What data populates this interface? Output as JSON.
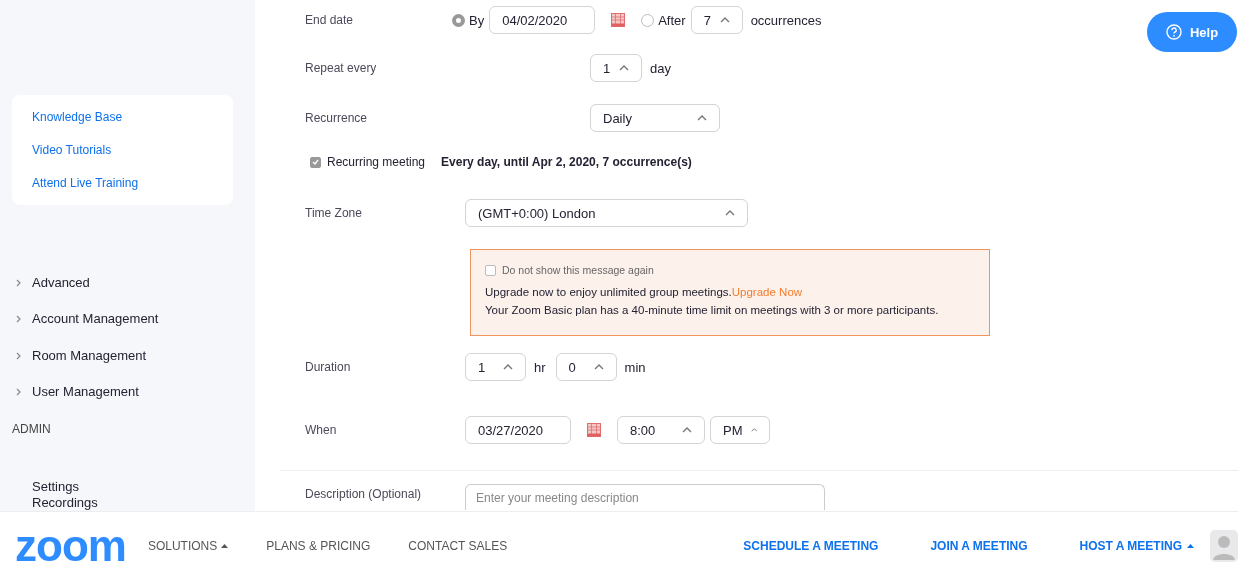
{
  "help_button": {
    "label": "Help"
  },
  "sidebar": {
    "help_links": [
      "Knowledge Base",
      "Video Tutorials",
      "Attend Live Training"
    ],
    "items": [
      {
        "label": "Advanced",
        "kind": "group",
        "expanded": false
      },
      {
        "label": "Account Management",
        "kind": "group",
        "expanded": false
      },
      {
        "label": "Room Management",
        "kind": "group",
        "expanded": false
      },
      {
        "label": "User Management",
        "kind": "group",
        "expanded": false
      },
      {
        "label": "ADMIN",
        "kind": "heading"
      },
      {
        "label": "Settings",
        "kind": "link"
      },
      {
        "label": "Recordings",
        "kind": "link"
      }
    ]
  },
  "form": {
    "end_date": {
      "label": "End date",
      "options": [
        {
          "kind": "by",
          "label": "By",
          "selected": true,
          "date": "04/02/2020"
        },
        {
          "kind": "after",
          "label": "After",
          "selected": false,
          "count": "7",
          "unit": "occurrences"
        }
      ]
    },
    "repeat_every": {
      "label": "Repeat every",
      "value": "1",
      "unit": "day"
    },
    "recurrence": {
      "label": "Recurrence",
      "value": "Daily"
    },
    "recurring": {
      "label": "Recurring meeting",
      "checked": true,
      "summary": "Every day, until Apr 2, 2020, 7 occurrence(s)"
    },
    "time_zone": {
      "label": "Time Zone",
      "value": "(GMT+0:00) London"
    },
    "alert": {
      "dont_show": {
        "label": "Do not show this message again",
        "checked": false
      },
      "upgrade_text": "Upgrade now to enjoy unlimited group meetings.",
      "upgrade_link": "Upgrade Now",
      "message": "Your Zoom Basic plan has a 40-minute time limit on meetings with 3 or more participants."
    },
    "duration": {
      "label": "Duration",
      "hours": "1",
      "hours_unit": "hr",
      "minutes": "0",
      "minutes_unit": "min"
    },
    "when": {
      "label": "When",
      "date": "03/27/2020",
      "time": "8:00",
      "ampm": "PM"
    },
    "description": {
      "label": "Description (Optional)",
      "placeholder": "Enter your meeting description"
    }
  },
  "nav": {
    "logo": "zoom",
    "left": [
      {
        "label": "SOLUTIONS",
        "has_menu": true
      },
      {
        "label": "PLANS & PRICING",
        "has_menu": false
      },
      {
        "label": "CONTACT SALES",
        "has_menu": false
      }
    ],
    "right": [
      {
        "label": "SCHEDULE A MEETING",
        "has_menu": false
      },
      {
        "label": "JOIN A MEETING",
        "has_menu": false
      },
      {
        "label": "HOST A MEETING",
        "has_menu": true
      }
    ]
  }
}
